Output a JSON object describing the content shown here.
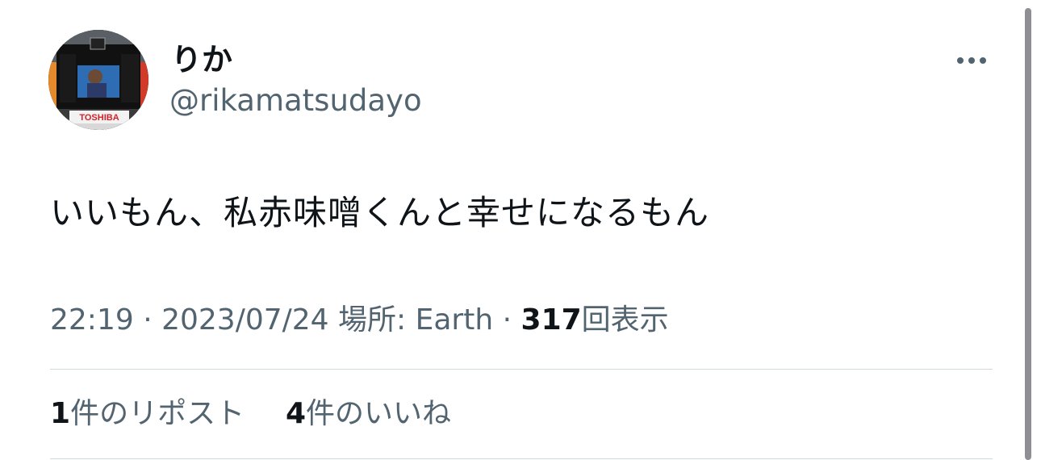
{
  "colors": {
    "primary_text": "#0f1419",
    "secondary_text": "#536471",
    "divider": "#cfd9de",
    "background": "#ffffff"
  },
  "author": {
    "display_name": "りか",
    "handle": "@rikamatsudayo",
    "avatar_icon": "stadium-scoreboard-avatar",
    "avatar_brand_text": "TOSHIBA"
  },
  "header": {
    "more_icon": "more-horizontal-icon"
  },
  "tweet": {
    "text": "いいもん、私赤味噌くんと幸せになるもん",
    "time": "22:19",
    "separator": " · ",
    "date": "2023/07/24",
    "location_label": "場所: Earth",
    "views_count": "317",
    "views_label": "回表示"
  },
  "stats": {
    "reposts_count": "1",
    "reposts_label": "件のリポスト",
    "likes_count": "4",
    "likes_label": "件のいいね"
  }
}
